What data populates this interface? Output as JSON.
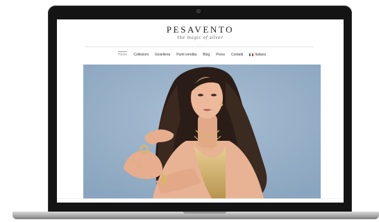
{
  "brand": {
    "name": "PESAVENTO",
    "tagline": "the magic of silver"
  },
  "nav": {
    "items": [
      "Home",
      "Collezioni",
      "Gioielleria",
      "Punti vendita",
      "Blog",
      "Press",
      "Contatti"
    ],
    "active": "Home",
    "language": "Italiano"
  },
  "colors": {
    "laptop_bezel": "#141414",
    "hero_background": "#9db6cc",
    "hair": "#2a1d17",
    "skin": "#e8b394",
    "gold": "#d8b56a"
  },
  "hero": {
    "subject": "model wearing gold jewellery"
  }
}
